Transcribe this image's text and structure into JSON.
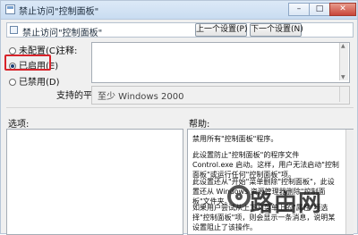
{
  "window": {
    "title": "禁止访问\"控制面板\"",
    "min_glyph": "–",
    "max_glyph": "□",
    "close_glyph": "✕"
  },
  "header": {
    "policy_name": "禁止访问\"控制面板\"",
    "prev_label": "上一个设置(P)",
    "next_label": "下一个设置(N)"
  },
  "options": {
    "not_configured": "未配置(C)",
    "enabled": "已启用(E)",
    "disabled": "已禁用(D)",
    "selected": "enabled"
  },
  "comment": {
    "label": "注释:",
    "value": ""
  },
  "platform": {
    "label": "支持的平台:",
    "value": "至少 Windows 2000"
  },
  "panels": {
    "options_label": "选项:",
    "help_label": "帮助:"
  },
  "help": {
    "p1": "禁用所有\"控制面板\"程序。",
    "p2": "此设置防止\"控制面板\"的程序文件 Control.exe 启动。这样，用户无法启动\"控制面板\"或运行任何\"控制面板\"项。",
    "p3": "此设置还从\"开始\"菜单删除\"控制面板\"，此设置还从 Windows 资源管理器删除\"控制面板\"文件夹。",
    "p4": "如果用户尝试从上下文菜单上的\"属性\"项选择\"控制面板\"项，则会显示一条消息，说明某设置阻止了该操作。"
  },
  "watermark": {
    "text": "路由网"
  }
}
